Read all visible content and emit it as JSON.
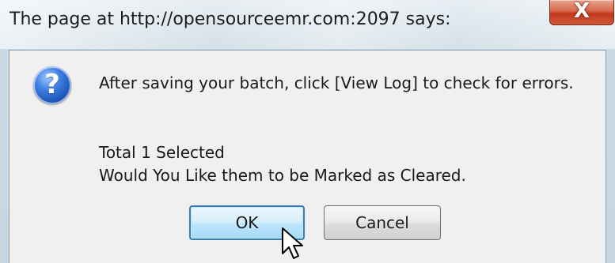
{
  "dialog": {
    "title": "The page at http://opensourceemr.com:2097 says:",
    "close_label": "X",
    "icon": "question-icon",
    "message_line1": "After saving your batch, click [View Log] to check for errors.",
    "message_line2": "Total 1 Selected",
    "message_line3": "Would You Like them to be Marked as Cleared.",
    "ok_label": "OK",
    "cancel_label": "Cancel"
  },
  "colors": {
    "titlebar": "#d4e0e8",
    "close_button": "#c2381b",
    "content_bg": "#f0f0f0",
    "ok_focus_border": "#3c7fb1",
    "icon_blue": "#1d55b8"
  }
}
